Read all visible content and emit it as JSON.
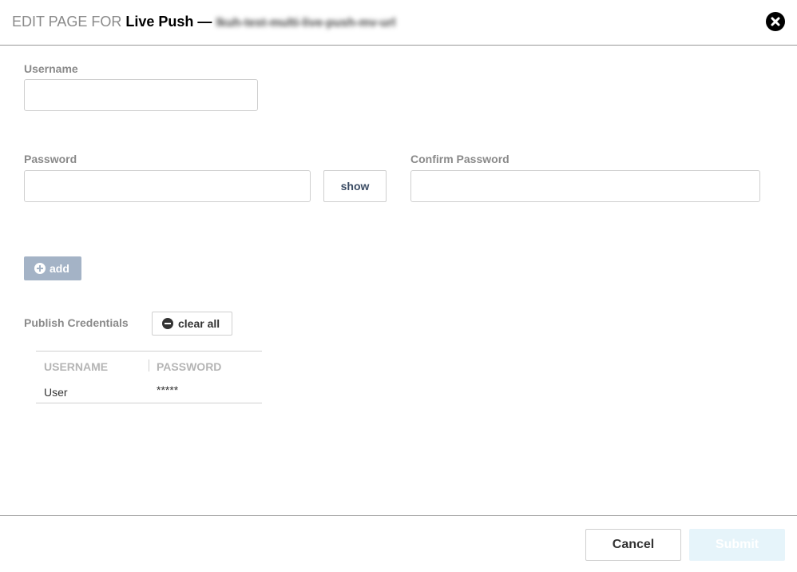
{
  "header": {
    "prefix": "EDIT PAGE FOR",
    "name": "Live Push",
    "separator": "—",
    "stream_name": "lkuh-test-multi-live-push-mv-url"
  },
  "form": {
    "username_label": "Username",
    "username_value": "",
    "password_label": "Password",
    "password_value": "",
    "show_label": "show",
    "confirm_label": "Confirm Password",
    "confirm_value": "",
    "add_label": "add"
  },
  "credentials": {
    "section_label": "Publish Credentials",
    "clear_label": "clear all",
    "columns": [
      "USERNAME",
      "PASSWORD"
    ],
    "rows": [
      {
        "username": "User",
        "password": "*****"
      }
    ]
  },
  "footer": {
    "cancel_label": "Cancel",
    "submit_label": "Submit"
  },
  "colors": {
    "add_button_bg": "#a4b3c6",
    "submit_button_bg": "#e6f4fa",
    "show_button_text": "#3a4b63"
  }
}
